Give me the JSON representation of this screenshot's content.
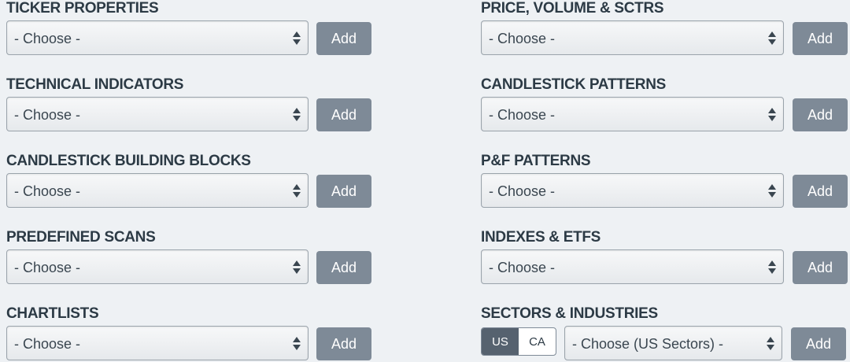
{
  "sections": {
    "ticker_properties": {
      "title": "TICKER PROPERTIES",
      "value": "- Choose -",
      "button": "Add"
    },
    "price_volume_sctrs": {
      "title": "PRICE, VOLUME & SCTRS",
      "value": "- Choose -",
      "button": "Add"
    },
    "technical_indicators": {
      "title": "TECHNICAL INDICATORS",
      "value": "- Choose -",
      "button": "Add"
    },
    "candlestick_patterns": {
      "title": "CANDLESTICK PATTERNS",
      "value": "- Choose -",
      "button": "Add"
    },
    "candlestick_building_blocks": {
      "title": "CANDLESTICK BUILDING BLOCKS",
      "value": "- Choose -",
      "button": "Add"
    },
    "pf_patterns": {
      "title": "P&F PATTERNS",
      "value": "- Choose -",
      "button": "Add"
    },
    "predefined_scans": {
      "title": "PREDEFINED SCANS",
      "value": "- Choose -",
      "button": "Add"
    },
    "indexes_etfs": {
      "title": "INDEXES & ETFS",
      "value": "- Choose -",
      "button": "Add"
    },
    "chartlists": {
      "title": "CHARTLISTS",
      "value": "- Choose -",
      "button": "Add"
    },
    "sectors_industries": {
      "title": "SECTORS & INDUSTRIES",
      "value": "- Choose (US Sectors) -",
      "button": "Add",
      "toggle": {
        "us": "US",
        "ca": "CA",
        "selected": "US"
      }
    }
  },
  "colors": {
    "background": "#eef1f4",
    "title": "#2c3a45",
    "button": "#7e8a97",
    "toggle_active": "#56626f"
  },
  "icons": {
    "select_arrows": "up-down-arrows-icon"
  }
}
